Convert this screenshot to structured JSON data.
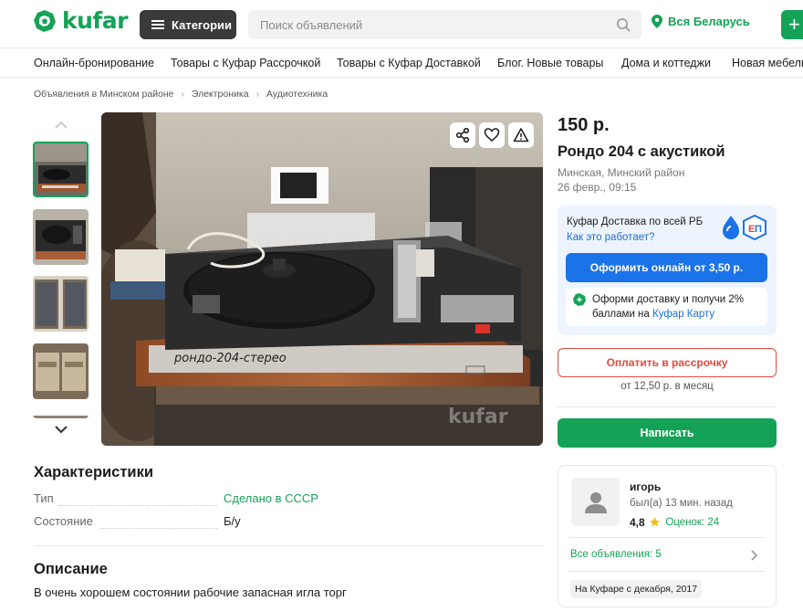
{
  "header": {
    "logo_text": "kufar",
    "categories_label": "Категории",
    "search_placeholder": "Поиск объявлений",
    "region_label": "Вся Беларусь",
    "post_ad_glyph": "+"
  },
  "category_nav": [
    "Онлайн-бронирование",
    "Товары с Куфар Рассрочкой",
    "Товары с Куфар Доставкой",
    "Блог. Новые товары",
    "Дома и коттеджи",
    "Новая мебель"
  ],
  "breadcrumbs": [
    "Объявления в Минском районе",
    "Электроника",
    "Аудиотехника"
  ],
  "photo": {
    "turntable_label": "рондо-204-стерео",
    "watermark": "kufar",
    "thumbnail_count": 5
  },
  "listing": {
    "price": "150 р.",
    "title": "Рондо 204 с акустикой",
    "location": "Минская, Минский район",
    "date": "26 февр., 09:15"
  },
  "delivery": {
    "title": "Куфар Доставка по всей РБ",
    "how_it_works": "Как это работает?",
    "order_button": "Оформить онлайн от 3,50 р.",
    "promo_text_1": "Оформи доставку и получи 2%",
    "promo_text_2": "баллами на",
    "promo_link": "Куфар Карту"
  },
  "installment": {
    "button": "Оплатить в рассрочку",
    "note": "от 12,50 р. в месяц"
  },
  "write_button": "Написать",
  "seller": {
    "name": "игорь",
    "last_seen": "был(а) 13 мин. назад",
    "rating": "4,8",
    "reviews": "Оценок: 24",
    "all_ads": "Все объявления: 5",
    "since": "На Куфаре с декабря, 2017"
  },
  "characteristics": {
    "heading": "Характеристики",
    "rows": [
      {
        "label": "Тип",
        "value": "Сделано в СССР"
      },
      {
        "label": "Состояние",
        "value": "Б/у"
      }
    ]
  },
  "description": {
    "heading": "Описание",
    "text": "В очень хорошем состоянии рабочие запасная игла торг"
  },
  "colors": {
    "brand_green": "#14a356",
    "delivery_blue": "#1a73e8",
    "installment_red": "#e04a3f"
  },
  "icons": [
    "logo-mark-icon",
    "menu-icon",
    "search-icon",
    "location-pin-icon",
    "plus-icon",
    "chevron-up-icon",
    "chevron-down-icon",
    "share-icon",
    "heart-icon",
    "warning-icon",
    "delivery-logo-icon",
    "kufar-card-icon",
    "user-avatar-icon",
    "star-icon",
    "chevron-right-icon"
  ]
}
